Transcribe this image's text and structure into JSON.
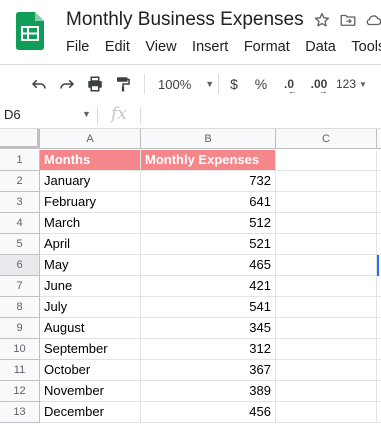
{
  "app": {
    "title": "Monthly Business Expenses",
    "menu": [
      "File",
      "Edit",
      "View",
      "Insert",
      "Format",
      "Data",
      "Tools"
    ]
  },
  "toolbar": {
    "zoom": "100%",
    "currency": "$",
    "percent": "%",
    "decrease_decimal": ".0",
    "increase_decimal": ".00",
    "more_formats": "123"
  },
  "formula_bar": {
    "cell_ref": "D6",
    "fx": "fx",
    "content": ""
  },
  "grid": {
    "columns": [
      "A",
      "B",
      "C"
    ],
    "row_numbers": [
      "1",
      "2",
      "3",
      "4",
      "5",
      "6",
      "7",
      "8",
      "9",
      "10",
      "11",
      "12",
      "13"
    ],
    "header": {
      "a": "Months",
      "b": "Monthly Expenses"
    },
    "rows": [
      {
        "a": "January",
        "b": "732"
      },
      {
        "a": "February",
        "b": "641"
      },
      {
        "a": "March",
        "b": "512"
      },
      {
        "a": "April",
        "b": "521"
      },
      {
        "a": "May",
        "b": "465"
      },
      {
        "a": "June",
        "b": "421"
      },
      {
        "a": "July",
        "b": "541"
      },
      {
        "a": "August",
        "b": "345"
      },
      {
        "a": "September",
        "b": "312"
      },
      {
        "a": "October",
        "b": "367"
      },
      {
        "a": "November",
        "b": "389"
      },
      {
        "a": "December",
        "b": "456"
      }
    ]
  },
  "colors": {
    "header_fill": "#f4868c",
    "header_text": "#ffffff",
    "logo_green": "#0f9d58",
    "selection": "#1a73e8"
  },
  "icons": [
    "sheets-logo-icon",
    "star-icon",
    "move-folder-icon",
    "cloud-status-icon",
    "undo-icon",
    "redo-icon",
    "print-icon",
    "paint-format-icon",
    "dropdown-caret-icon"
  ]
}
